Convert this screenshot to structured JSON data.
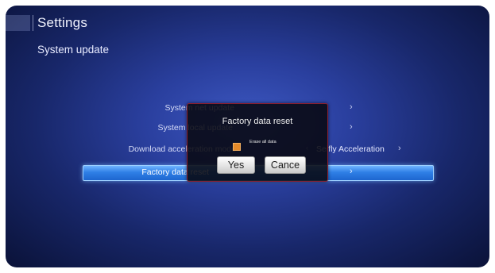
{
  "header": {
    "title": "Settings",
    "subtitle": "System update"
  },
  "menu": {
    "rows": [
      {
        "label": "System net update",
        "arrow": "›"
      },
      {
        "label": "System local update",
        "arrow": "›"
      },
      {
        "label": "Download acceleration mode",
        "value": "Seifly Acceleration",
        "arrow": "›",
        "left_arrow": "‹"
      },
      {
        "label": "Factory data reset",
        "arrow": "›",
        "selected": true
      }
    ]
  },
  "dialog": {
    "title": "Factory data reset",
    "checkbox_label": "Erase all data",
    "checkbox_checked": true,
    "yes_label": "Yes",
    "cancel_label": "Cance"
  },
  "colors": {
    "background": "#2a3f9e",
    "selection": "#2f7fe6",
    "dialog_border": "#8a1f2f",
    "checkbox": "#e48a2a"
  }
}
